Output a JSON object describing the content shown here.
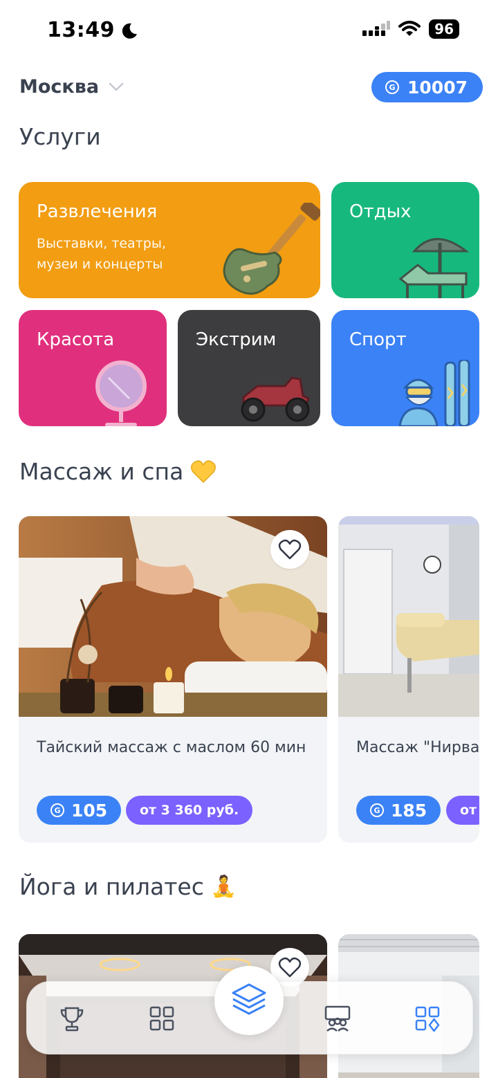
{
  "status_bar": {
    "time": "13:49",
    "battery": "96"
  },
  "header": {
    "city": "Москва",
    "balance": "10007"
  },
  "services": {
    "title": "Услуги",
    "tiles": [
      {
        "title": "Развлечения",
        "subtitle": "Выставки, театры, музеи и концерты",
        "color": "#f29d12",
        "icon": "guitar-icon"
      },
      {
        "title": "Отдых",
        "color": "#17b87e",
        "icon": "beach-umbrella-icon"
      },
      {
        "title": "Красота",
        "color": "#e0307d",
        "icon": "mirror-icon"
      },
      {
        "title": "Экстрим",
        "color": "#3d3d3f",
        "icon": "quad-bike-icon"
      },
      {
        "title": "Спорт",
        "color": "#3b82f6",
        "icon": "skier-icon"
      }
    ]
  },
  "massage": {
    "title": "Массаж и спа",
    "emoji": "💛",
    "cards": [
      {
        "title": "Тайский массаж с маслом 60 мин",
        "points": "105",
        "price": "от 3 360 руб."
      },
      {
        "title": "Массаж \"Нирва",
        "points": "185",
        "price": "от"
      }
    ]
  },
  "yoga": {
    "title": "Йога и пилатес",
    "emoji": "🧘"
  },
  "nav": {
    "items": [
      "trophy-icon",
      "grid-icon",
      "layers-icon",
      "community-icon",
      "widgets-icon"
    ],
    "active": "layers-icon"
  },
  "colors": {
    "accent": "#3b82f6",
    "price_pill": "#7b61ff",
    "text": "#3a4250"
  }
}
